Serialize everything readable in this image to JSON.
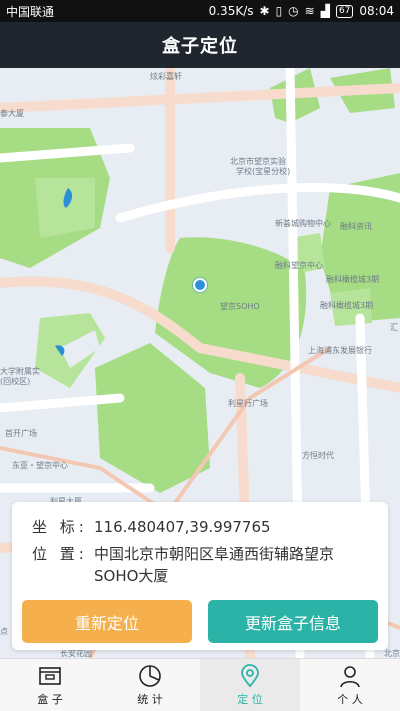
{
  "status_bar": {
    "carrier": "中国联通",
    "speed": "0.35K/s",
    "battery": "67",
    "time": "08:04",
    "icons": [
      "bluetooth-icon",
      "vibrate-icon",
      "alarm-icon",
      "wifi-icon",
      "signal-icon",
      "battery-icon"
    ]
  },
  "header": {
    "title": "盒子定位"
  },
  "map": {
    "labels": {
      "l1": "炫彩嘉轩",
      "l2": "泰大厦",
      "l3": "北京市望京实验",
      "l4": "学校(宝星分校)",
      "l5": "新荟城购物中心",
      "l6": "融科资讯",
      "l7": "融科望京中心",
      "l8": "融科橄榄城3期",
      "l9": "望京SOHO",
      "l10": "汇",
      "l11": "上海浦东发展银行",
      "l12": "大学附属实",
      "l13": "(回校区)",
      "l14": "利星行广场",
      "l15": "首开广场",
      "l16": "方恒时代",
      "l17": "东亚・望京中心",
      "l18": "利星大厦",
      "l19": "点",
      "l20": "长安花园",
      "l21": "北京"
    },
    "location_marker": "location-pin-icon"
  },
  "info": {
    "coord_label": "坐 标:",
    "coord_value": "116.480407,39.997765",
    "addr_label": "位 置:",
    "addr_value": "中国北京市朝阳区阜通西街辅路望京SOHO大厦"
  },
  "buttons": {
    "relocate": "重新定位",
    "update": "更新盒子信息"
  },
  "colors": {
    "relocate_button": "#f5b04d",
    "update_button": "#2ab3a6",
    "header_bg": "#20262e",
    "active_tab": "#2ab3a6"
  },
  "nav": {
    "items": [
      {
        "label": "盒 子",
        "icon": "box-icon"
      },
      {
        "label": "统 计",
        "icon": "pie-chart-icon"
      },
      {
        "label": "定 位",
        "icon": "location-icon",
        "active": true
      },
      {
        "label": "个 人",
        "icon": "person-icon"
      }
    ]
  }
}
